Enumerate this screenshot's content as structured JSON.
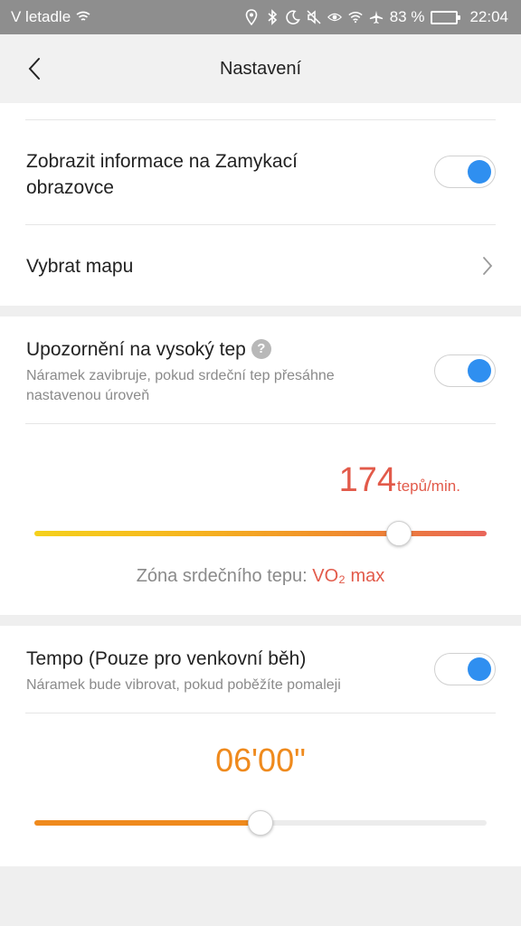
{
  "status_bar": {
    "carrier": "V letadle",
    "battery_text": "83 %",
    "time": "22:04",
    "battery_level": 0.83
  },
  "header": {
    "title": "Nastavení"
  },
  "lock_screen": {
    "title_line1": "Zobrazit informace na Zamykací",
    "title_line2": "obrazovce",
    "toggle_on": true
  },
  "map": {
    "title": "Vybrat mapu"
  },
  "heart_rate": {
    "title": "Upozornění na vysoký tep",
    "help": "?",
    "desc_line1": "Náramek zavibruje, pokud srdeční tep přesáhne",
    "desc_line2": "nastavenou úroveň",
    "toggle_on": true,
    "value": "174",
    "unit": "tepů/min.",
    "slider_fraction": 0.805,
    "zone_label": "Zóna srdečního tepu: ",
    "zone_value": "VO₂ max"
  },
  "pace": {
    "title": "Tempo (Pouze pro venkovní běh)",
    "desc": "Náramek bude vibrovat, pokud poběžíte pomaleji",
    "toggle_on": true,
    "value": "06'00\"",
    "slider_fraction": 0.5
  },
  "colors": {
    "accent_blue": "#2f8ff0",
    "heart_red": "#e25a4a",
    "pace_orange": "#ef8a1d"
  }
}
